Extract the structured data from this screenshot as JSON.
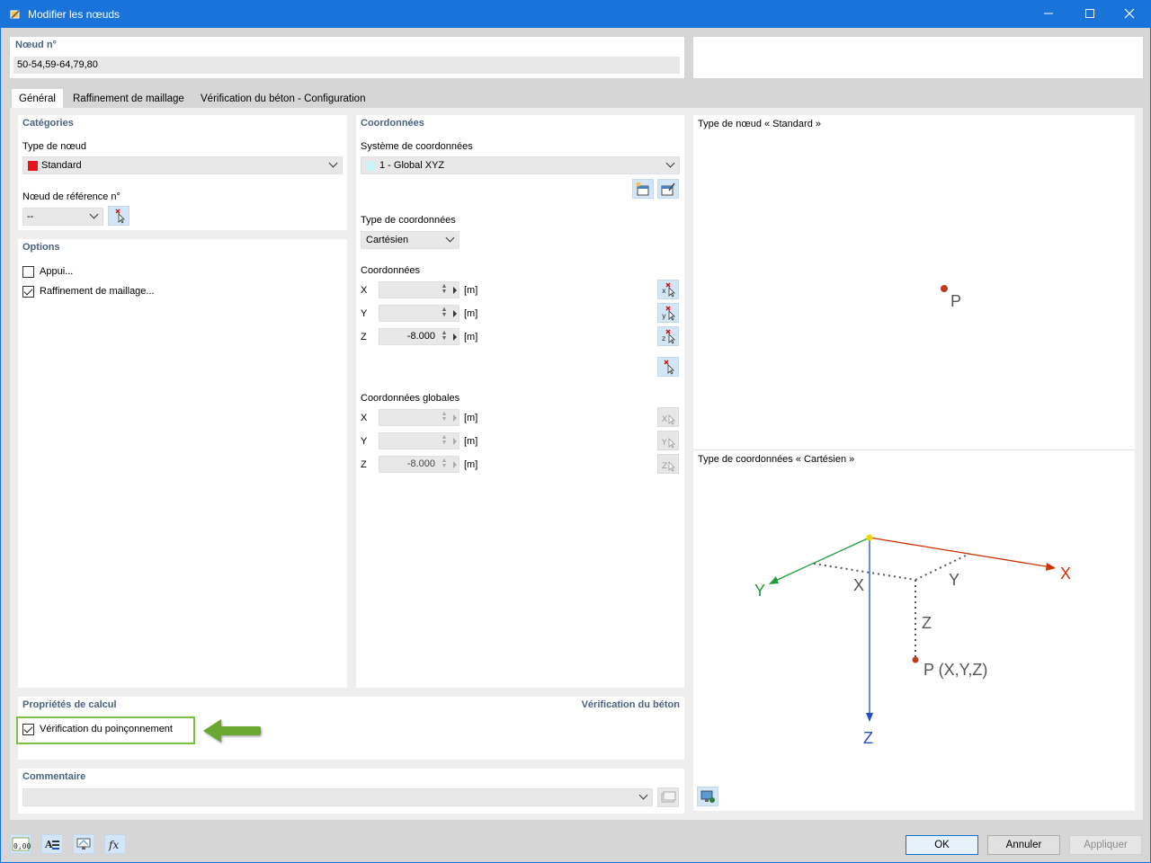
{
  "window": {
    "title": "Modifier les nœuds"
  },
  "header": {
    "node_label": "Nœud n°",
    "node_value": "50-54,59-64,79,80"
  },
  "tabs": [
    {
      "label": "Général"
    },
    {
      "label": "Raffinement de maillage"
    },
    {
      "label": "Vérification du béton - Configuration"
    }
  ],
  "categories": {
    "title": "Catégories",
    "node_type_label": "Type de nœud",
    "node_type_value": "Standard",
    "node_type_color": "#e8141b",
    "ref_node_label": "Nœud de référence n°",
    "ref_node_value": "--"
  },
  "options": {
    "title": "Options",
    "support_label": "Appui...",
    "support_checked": false,
    "mesh_label": "Raffinement de maillage...",
    "mesh_checked": true
  },
  "coordinates": {
    "title": "Coordonnées",
    "system_label": "Système de coordonnées",
    "system_value": "1 - Global XYZ",
    "system_color": "#c9f3f6",
    "type_label": "Type de coordonnées",
    "type_value": "Cartésien",
    "coords_label": "Coordonnées",
    "x_label": "X",
    "x_value": "",
    "y_label": "Y",
    "y_value": "",
    "z_label": "Z",
    "z_value": "-8.000",
    "unit": "[m]",
    "global_label": "Coordonnées globales",
    "gx_label": "X",
    "gx_value": "",
    "gy_label": "Y",
    "gy_value": "",
    "gz_label": "Z",
    "gz_value": "-8.000"
  },
  "calc": {
    "title": "Propriétés de calcul",
    "right_title": "Vérification du béton",
    "punching_label": "Vérification du poinçonnement",
    "punching_checked": true,
    "highlight_color": "#7ac142"
  },
  "comment": {
    "title": "Commentaire",
    "value": ""
  },
  "preview": {
    "node_type_caption": "Type de nœud « Standard »",
    "point_label": "P",
    "coord_type_caption": "Type de coordonnées « Cartésien »",
    "axis_x": "X",
    "axis_y": "Y",
    "axis_z": "Z",
    "dim_x": "X",
    "dim_y": "Y",
    "dim_z": "Z",
    "point_full": "P (X,Y,Z)",
    "color_x": "#cc3300",
    "color_y": "#1f9e3a",
    "color_z": "#1d4fc9"
  },
  "buttons": {
    "ok": "OK",
    "cancel": "Annuler",
    "apply": "Appliquer"
  },
  "bottom_icons": {
    "units_text": "0,00",
    "fx_text": "fx"
  }
}
